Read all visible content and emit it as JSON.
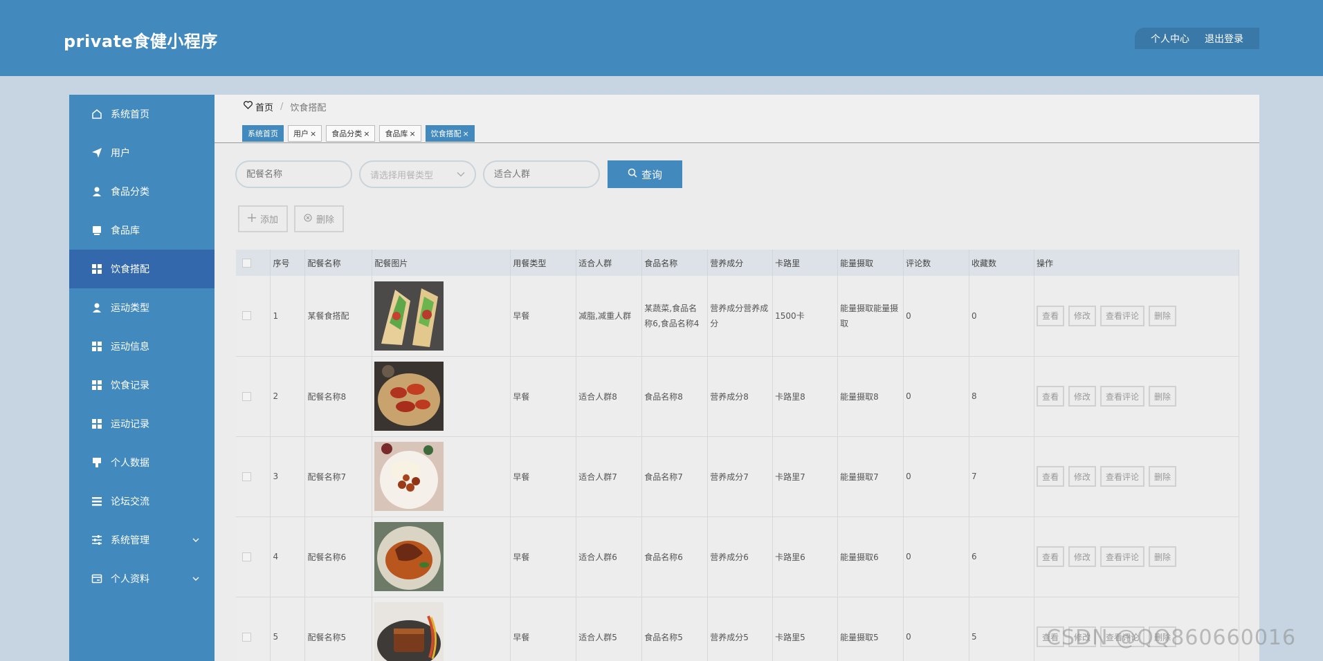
{
  "app": {
    "title": "private食健小程序"
  },
  "header": {
    "personal_center": "个人中心",
    "logout": "退出登录"
  },
  "sidebar": {
    "items": [
      {
        "label": "系统首页",
        "icon": "home-icon"
      },
      {
        "label": "用户",
        "icon": "send-icon"
      },
      {
        "label": "食品分类",
        "icon": "person-icon"
      },
      {
        "label": "食品库",
        "icon": "box-icon"
      },
      {
        "label": "饮食搭配",
        "icon": "grid-icon",
        "active": true
      },
      {
        "label": "运动类型",
        "icon": "person-icon"
      },
      {
        "label": "运动信息",
        "icon": "grid-icon"
      },
      {
        "label": "饮食记录",
        "icon": "grid-icon"
      },
      {
        "label": "运动记录",
        "icon": "grid-icon"
      },
      {
        "label": "个人数据",
        "icon": "pin-icon"
      },
      {
        "label": "论坛交流",
        "icon": "list-icon"
      },
      {
        "label": "系统管理",
        "icon": "sliders-icon",
        "expandable": true
      },
      {
        "label": "个人资料",
        "icon": "card-icon",
        "expandable": true
      }
    ]
  },
  "breadcrumb": {
    "home": "首页",
    "separator": "/",
    "current": "饮食搭配"
  },
  "tabs": [
    {
      "label": "系统首页",
      "closable": false,
      "active": false
    },
    {
      "label": "用户",
      "closable": true,
      "active": false
    },
    {
      "label": "食品分类",
      "closable": true,
      "active": false
    },
    {
      "label": "食品库",
      "closable": true,
      "active": false
    },
    {
      "label": "饮食搭配",
      "closable": true,
      "active": true
    }
  ],
  "search": {
    "name_placeholder": "配餐名称",
    "type_placeholder": "请选择用餐类型",
    "crowd_placeholder": "适合人群",
    "query_label": "查询"
  },
  "actions": {
    "add_label": "添加",
    "delete_label": "删除"
  },
  "table": {
    "headers": [
      "序号",
      "配餐名称",
      "配餐图片",
      "用餐类型",
      "适合人群",
      "食品名称",
      "营养成分",
      "卡路里",
      "能量摄取",
      "评论数",
      "收藏数",
      "操作"
    ],
    "rows": [
      {
        "no": "1",
        "name": "某餐食搭配",
        "image": "wrap-photo",
        "meal_type": "早餐",
        "crowd": "减脂,减重人群",
        "food": "某蔬菜,食品名称6,食品名称4",
        "nutrition": "营养成分营养成分",
        "calories": "1500卡",
        "energy": "能量摄取能量摄取",
        "comments": "0",
        "favorites": "0"
      },
      {
        "no": "2",
        "name": "配餐名称8",
        "image": "chicken-wings-photo",
        "meal_type": "早餐",
        "crowd": "适合人群8",
        "food": "食品名称8",
        "nutrition": "营养成分8",
        "calories": "卡路里8",
        "energy": "能量摄取8",
        "comments": "0",
        "favorites": "8"
      },
      {
        "no": "3",
        "name": "配餐名称7",
        "image": "meatballs-photo",
        "meal_type": "早餐",
        "crowd": "适合人群7",
        "food": "食品名称7",
        "nutrition": "营养成分7",
        "calories": "卡路里7",
        "energy": "能量摄取7",
        "comments": "0",
        "favorites": "7"
      },
      {
        "no": "4",
        "name": "配餐名称6",
        "image": "sauce-dish-photo",
        "meal_type": "早餐",
        "crowd": "适合人群6",
        "food": "食品名称6",
        "nutrition": "营养成分6",
        "calories": "卡路里6",
        "energy": "能量摄取6",
        "comments": "0",
        "favorites": "6"
      },
      {
        "no": "5",
        "name": "配餐名称5",
        "image": "pork-belly-photo",
        "meal_type": "早餐",
        "crowd": "适合人群5",
        "food": "食品名称5",
        "nutrition": "营养成分5",
        "calories": "卡路里5",
        "energy": "能量摄取5",
        "comments": "0",
        "favorites": "5"
      }
    ],
    "op_labels": {
      "view": "查看",
      "edit": "修改",
      "view_comments": "查看评论",
      "delete": "删除"
    }
  },
  "watermark": "CSDN @QQ860660016",
  "colors": {
    "primary": "#4289be",
    "active_menu": "#3468ac",
    "page_bg": "#c6d5e1"
  }
}
